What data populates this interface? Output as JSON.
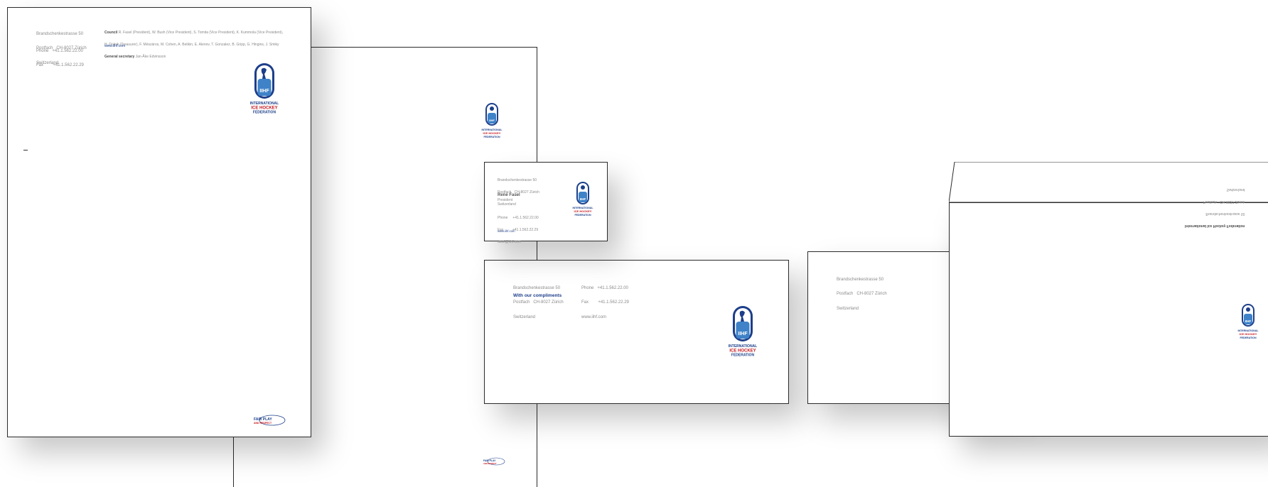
{
  "letterhead": {
    "address": [
      "Brandschenkestrasse 50",
      "Postfach   CH-8027 Zürich",
      "Switzerland"
    ],
    "phone": "Phone   +41.1.562.22.00",
    "fax": "Fax        +41.1.562.22.29",
    "council_label": "Council",
    "council_line1": "R. Fasel (President), W. Bush (Vice President), S. Tomita (Vice President), K. Kummola (Vice President),",
    "council_line2": "H. Dolnik (Treasurer), F. Mészáros, M. Cohen, A. Belikin, E. Alenov, T. Gonzalez, B. Gripp, G. Hingins, J. Smiky",
    "secretary_label": "General secretary",
    "secretary_name": "Jan-Åke Edvinsson",
    "website": "www.iihf.com"
  },
  "business_card": {
    "address": [
      "Brandschenkestrasse 50",
      "Postfach   CH-8027 Zürich",
      "Switzerland"
    ],
    "name": "René Fasel",
    "title": "President",
    "phone": "Phone     +41.1.562.22.00",
    "fax": "Fax         +41.1.562.22.29",
    "email": "fasel@iihf.com",
    "website": "www.iihf.com"
  },
  "compliments_slip": {
    "address": [
      "Brandschenkestrasse 50",
      "Postfach   CH-8027 Zürich",
      "Switzerland"
    ],
    "phone": "Phone   +41.1.562.22.00",
    "fax": "Fax        +41.1.562.22.29",
    "website": "www.iihf.com",
    "tagline": "With our compliments"
  },
  "envelope_front": {
    "address": [
      "Brandschenkestrasse 50",
      "Postfach   CH-8027 Zürich",
      "Switzerland"
    ]
  },
  "envelope_flap": {
    "lines": [
      "International Ice Hockey Federation",
      "Brandschenkestrasse 50",
      "Postfach   CH-8027 Zürich",
      "Switzerland"
    ]
  },
  "logo": {
    "initials": "IIHF",
    "line1": "INTERNATIONAL",
    "line2": "ICE HOCKEY",
    "line3": "FEDERATION"
  },
  "fair_play": {
    "line1": "FAIR PLAY",
    "line2": "AND RESPECT"
  },
  "colors": {
    "navy": "#1d3f8a",
    "red": "#c5161d",
    "border": "#2b2b2b"
  }
}
